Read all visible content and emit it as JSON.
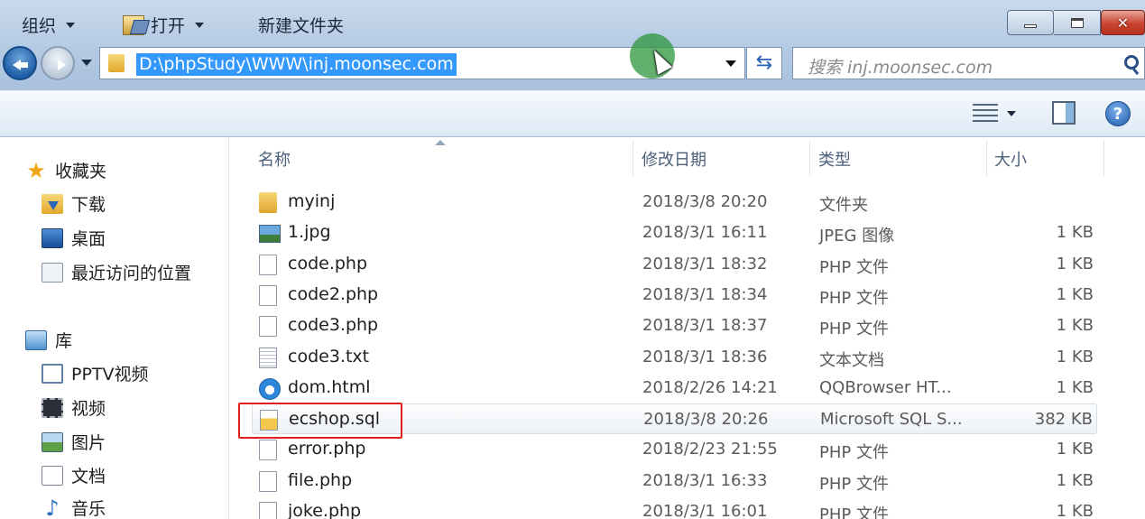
{
  "window": {
    "minimize_icon": "minimize-icon",
    "maximize_icon": "maximize-icon",
    "close_glyph": "✕"
  },
  "address_bar": {
    "path": "D:\\phpStudy\\WWW\\inj.moonsec.com",
    "refresh_glyph": "⇆"
  },
  "search": {
    "placeholder": "搜索 inj.moonsec.com"
  },
  "toolbar": {
    "organize": "组织",
    "open": "打开",
    "new_folder": "新建文件夹",
    "help_glyph": "?"
  },
  "sidebar": {
    "favorites": {
      "label": "收藏夹",
      "items": [
        {
          "label": "下载",
          "icon": "downloads-folder-icon"
        },
        {
          "label": "桌面",
          "icon": "desktop-icon"
        },
        {
          "label": "最近访问的位置",
          "icon": "recent-places-icon"
        }
      ]
    },
    "libraries": {
      "label": "库",
      "items": [
        {
          "label": "PPTV视频",
          "icon": "pptv-video-icon"
        },
        {
          "label": "视频",
          "icon": "video-library-icon"
        },
        {
          "label": "图片",
          "icon": "pictures-library-icon"
        },
        {
          "label": "文档",
          "icon": "documents-library-icon"
        },
        {
          "label": "音乐",
          "icon": "music-library-icon"
        }
      ]
    }
  },
  "columns": {
    "name": "名称",
    "date": "修改日期",
    "type": "类型",
    "size": "大小"
  },
  "files": [
    {
      "name": "myinj",
      "date": "2018/3/8 20:20",
      "type": "文件夹",
      "size": "",
      "icon": "folder"
    },
    {
      "name": "1.jpg",
      "date": "2018/3/1 16:11",
      "type": "JPEG 图像",
      "size": "1 KB",
      "icon": "image"
    },
    {
      "name": "code.php",
      "date": "2018/3/1 18:32",
      "type": "PHP 文件",
      "size": "1 KB",
      "icon": "page"
    },
    {
      "name": "code2.php",
      "date": "2018/3/1 18:34",
      "type": "PHP 文件",
      "size": "1 KB",
      "icon": "page"
    },
    {
      "name": "code3.php",
      "date": "2018/3/1 18:37",
      "type": "PHP 文件",
      "size": "1 KB",
      "icon": "page"
    },
    {
      "name": "code3.txt",
      "date": "2018/3/1 18:36",
      "type": "文本文档",
      "size": "1 KB",
      "icon": "text"
    },
    {
      "name": "dom.html",
      "date": "2018/2/26 14:21",
      "type": "QQBrowser HT...",
      "size": "1 KB",
      "icon": "browser"
    },
    {
      "name": "ecshop.sql",
      "date": "2018/3/8 20:26",
      "type": "Microsoft SQL S...",
      "size": "382 KB",
      "icon": "sql",
      "selected": true
    },
    {
      "name": "error.php",
      "date": "2018/2/23 21:55",
      "type": "PHP 文件",
      "size": "1 KB",
      "icon": "page"
    },
    {
      "name": "file.php",
      "date": "2018/3/1 16:33",
      "type": "PHP 文件",
      "size": "1 KB",
      "icon": "page"
    },
    {
      "name": "joke.php",
      "date": "2018/3/1 16:01",
      "type": "PHP 文件",
      "size": "1 KB",
      "icon": "page"
    }
  ],
  "colors": {
    "selection_highlight": "#3399ff",
    "annotation_box": "#e0201f",
    "cursor_marker": "#2e963c"
  }
}
